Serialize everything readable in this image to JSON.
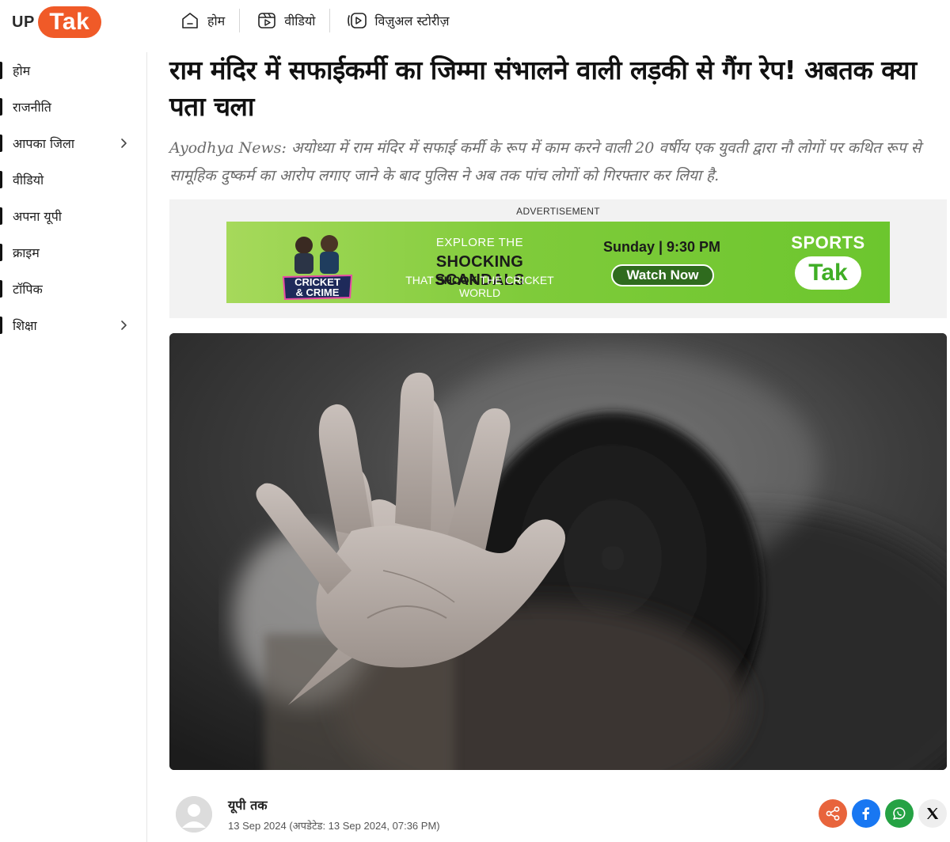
{
  "brand": {
    "up": "UP",
    "tak": "Tak",
    "accent": "#f05a28"
  },
  "topnav": [
    {
      "label": "होम",
      "icon": "home-icon"
    },
    {
      "label": "वीडियो",
      "icon": "video-reel-icon"
    },
    {
      "label": "विज़ुअल स्टोरीज़",
      "icon": "play-stories-icon"
    }
  ],
  "sidebar": {
    "items": [
      {
        "label": "होम",
        "has_submenu": false
      },
      {
        "label": "राजनीति",
        "has_submenu": false
      },
      {
        "label": "आपका जिला",
        "has_submenu": true
      },
      {
        "label": "वीडियो",
        "has_submenu": false
      },
      {
        "label": "अपना यूपी",
        "has_submenu": false
      },
      {
        "label": "क्राइम",
        "has_submenu": false
      },
      {
        "label": "टॉपिक",
        "has_submenu": false
      },
      {
        "label": "शिक्षा",
        "has_submenu": true
      }
    ]
  },
  "article": {
    "headline": "राम मंदिर में सफाईकर्मी का जिम्मा संभालने वाली लड़की से गैंग रेप! अबतक क्या पता चला",
    "summary": "Ayodhya News: अयोध्या में राम मंदिर में सफाई कर्मी के रूप में काम करने वाली 20 वर्षीय एक युवती द्वारा नौ लोगों पर कथित रूप से सामूहिक दुष्कर्म का आरोप लगाए जाने के बाद पुलिस ने अब तक पांच लोगों को गिरफ्तार कर लिया है.",
    "author": "यूपी तक",
    "dateline": "13 Sep 2024 (अपडेटेड: 13 Sep 2024, 07:36 PM)"
  },
  "ad": {
    "label": "ADVERTISEMENT",
    "show_logo_line1": "CRICKET",
    "show_logo_line2": "& CRIME",
    "explore": "EXPLORE THE",
    "shocking": "SHOCKING SCANDALS",
    "shook_pre": "THAT",
    "shook_bold": "SHOOK",
    "shook_post": "THE CRICKET WORLD",
    "schedule": "Sunday | 9:30 PM",
    "cta": "Watch Now",
    "sports": "SPORTS",
    "tak": "Tak"
  },
  "share": [
    {
      "icon": "share-icon",
      "color": "#e8643c"
    },
    {
      "icon": "facebook-icon",
      "color": "#1877f2"
    },
    {
      "icon": "whatsapp-icon",
      "color": "#25a244"
    },
    {
      "icon": "x-icon",
      "color": "#eeeeee"
    }
  ]
}
